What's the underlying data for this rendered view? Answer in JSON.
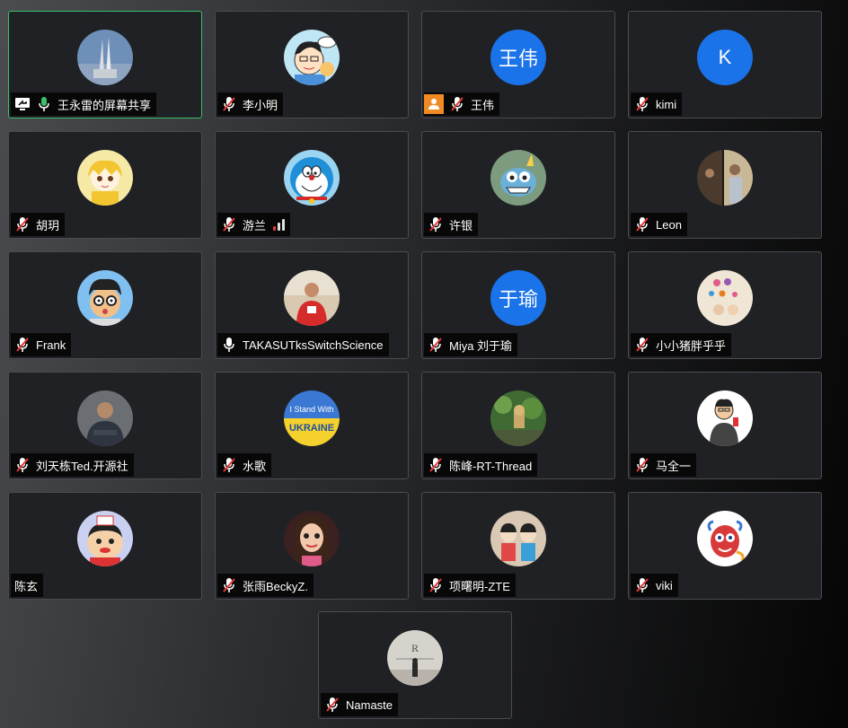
{
  "participants": [
    {
      "name": "王永雷的屏幕共享",
      "avatar_text": "",
      "mic": "on",
      "share": true,
      "active": true
    },
    {
      "name": "李小明",
      "avatar_text": "",
      "mic": "muted"
    },
    {
      "name": "王伟",
      "avatar_text": "王伟",
      "mic": "muted",
      "badge": true
    },
    {
      "name": "kimi",
      "avatar_text": "K",
      "mic": "muted"
    },
    {
      "name": "胡玥",
      "avatar_text": "",
      "mic": "muted"
    },
    {
      "name": "游兰",
      "avatar_text": "",
      "mic": "muted",
      "signal": "weak"
    },
    {
      "name": "许银",
      "avatar_text": "",
      "mic": "muted"
    },
    {
      "name": "Leon",
      "avatar_text": "",
      "mic": "muted"
    },
    {
      "name": "Frank",
      "avatar_text": "",
      "mic": "muted"
    },
    {
      "name": "TAKASUTksSwitchScience",
      "avatar_text": "",
      "mic": "on"
    },
    {
      "name": "Miya 刘于瑜",
      "avatar_text": "于瑜",
      "mic": "muted"
    },
    {
      "name": "小小猪胖乎乎",
      "avatar_text": "",
      "mic": "muted"
    },
    {
      "name": "刘天栋Ted.开源社",
      "avatar_text": "",
      "mic": "muted"
    },
    {
      "name": "水歌",
      "avatar_text": "",
      "mic": "muted"
    },
    {
      "name": "陈峰-RT-Thread",
      "avatar_text": "",
      "mic": "muted"
    },
    {
      "name": "马全一",
      "avatar_text": "",
      "mic": "muted"
    },
    {
      "name": "陈玄",
      "avatar_text": "",
      "mic": "none"
    },
    {
      "name": "张雨BeckyZ.",
      "avatar_text": "",
      "mic": "muted"
    },
    {
      "name": "项曙明-ZTE",
      "avatar_text": "",
      "mic": "muted"
    },
    {
      "name": "viki",
      "avatar_text": "",
      "mic": "muted"
    },
    {
      "name": "Namaste",
      "avatar_text": "",
      "mic": "muted"
    }
  ],
  "poster_text": {
    "line1": "I Stand With",
    "line2": "UKRAINE"
  },
  "colors": {
    "accent": "#1a73e8",
    "active_border": "#3bbf6a",
    "mic_on": "#3bbf6a",
    "muted_slash": "#e53935",
    "badge": "#f08a24"
  }
}
